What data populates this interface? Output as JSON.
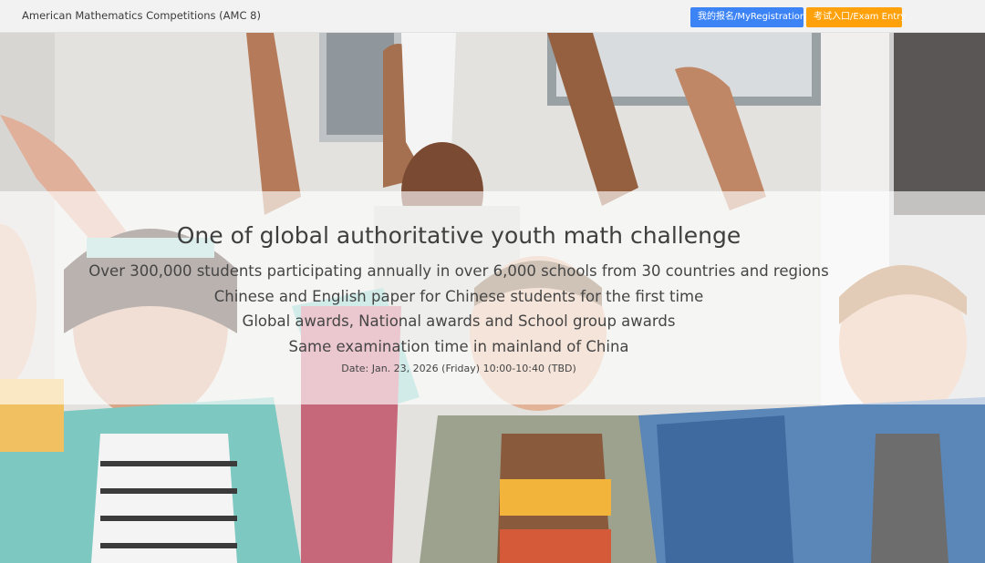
{
  "navbar": {
    "brand": "American Mathematics Competitions (AMC 8)",
    "registration_button": "我的报名/MyRegistration",
    "exam_entry_button": "考试入口/Exam Entry"
  },
  "hero": {
    "title": "One of global authoritative youth math challenge",
    "lines": [
      "Over 300,000 students participating annually in over 6,000 schools from 30 countries and regions",
      "Chinese and English paper for Chinese students for the first time",
      "Global awards, National awards and School group awards",
      "Same examination time in mainland of China"
    ],
    "date": "Date: Jan. 23, 2026 (Friday) 10:00-10:40 (TBD)"
  },
  "colors": {
    "registration_button": "#3c83f5",
    "exam_entry_button": "#ffa10a",
    "navbar": "#f2f2f2"
  }
}
